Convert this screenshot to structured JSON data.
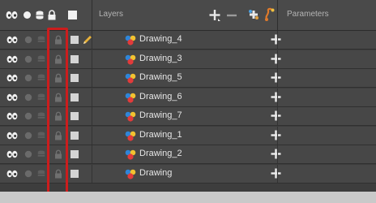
{
  "header": {
    "layers_label": "Layers",
    "parameters_label": "Parameters",
    "icons": [
      "show-all-icon",
      "solo-icon",
      "stack-icon",
      "lock-all-icon",
      "color-swatch-icon",
      "add-layer-icon",
      "remove-layer-icon",
      "add-peg-icon",
      "deformer-icon"
    ]
  },
  "layers": [
    {
      "name": "Drawing_4",
      "current": true
    },
    {
      "name": "Drawing_3",
      "current": false
    },
    {
      "name": "Drawing_5",
      "current": false
    },
    {
      "name": "Drawing_6",
      "current": false
    },
    {
      "name": "Drawing_7",
      "current": false
    },
    {
      "name": "Drawing_1",
      "current": false
    },
    {
      "name": "Drawing_2",
      "current": false
    },
    {
      "name": "Drawing",
      "current": false
    }
  ],
  "colors": {
    "panel_bg": "#3d3d3d",
    "row_bg": "#474747",
    "highlight": "#cc1d1d",
    "text": "#e6e6e6",
    "pencil": "#e8b23a"
  }
}
